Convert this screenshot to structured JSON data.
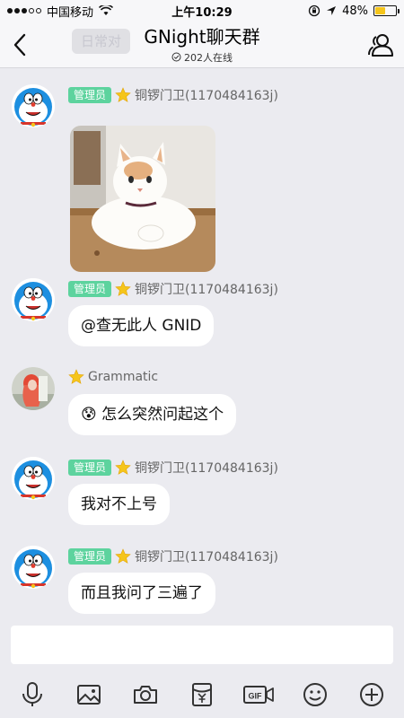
{
  "status": {
    "carrier": "中国移动",
    "time": "上午10:29",
    "battery": "48%",
    "battery_level": 0.48
  },
  "header": {
    "ghost_text": "日常对",
    "title": "GNight聊天群",
    "online": "202人在线"
  },
  "messages": [
    {
      "badge": "管理员",
      "sender": "铜锣门卫(1170484163j)",
      "type": "image",
      "image_icon": "cat-photo"
    },
    {
      "badge": "管理员",
      "sender": "铜锣门卫(1170484163j)",
      "type": "text",
      "text": "@查无此人 GNID"
    },
    {
      "badge": "",
      "sender": "Grammatic",
      "type": "text",
      "text": "😰 怎么突然问起这个"
    },
    {
      "badge": "管理员",
      "sender": "铜锣门卫(1170484163j)",
      "type": "text",
      "text": "我对不上号"
    },
    {
      "badge": "管理员",
      "sender": "铜锣门卫(1170484163j)",
      "type": "text",
      "text": "而且我问了三遍了"
    }
  ],
  "toolbar": {
    "icons": [
      "microphone-icon",
      "image-icon",
      "camera-icon",
      "red-packet-icon",
      "gif-icon",
      "emoji-icon",
      "plus-icon"
    ]
  },
  "colors": {
    "admin_badge": "#5dd39e",
    "star": "#f5c51b",
    "background": "#ebebf0"
  }
}
